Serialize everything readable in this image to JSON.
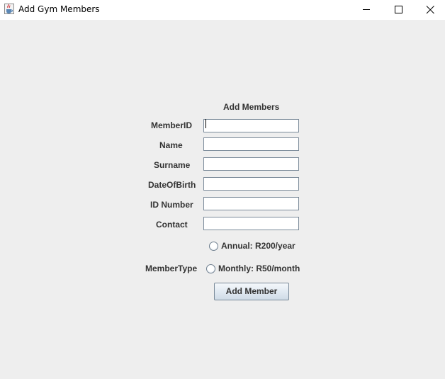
{
  "window": {
    "title": "Add Gym Members"
  },
  "form": {
    "heading": "Add Members",
    "fields": [
      {
        "label": "MemberID",
        "value": ""
      },
      {
        "label": "Name",
        "value": ""
      },
      {
        "label": "Surname",
        "value": ""
      },
      {
        "label": "DateOfBirth",
        "value": ""
      },
      {
        "label": "ID Number",
        "value": ""
      },
      {
        "label": "Contact",
        "value": ""
      }
    ],
    "member_type_label": "MemberType",
    "options": [
      {
        "label": "Annual: R200/year",
        "selected": false
      },
      {
        "label": "Monthly: R50/month",
        "selected": false
      }
    ],
    "submit_label": "Add Member"
  },
  "icons": {
    "app": "java-cup-icon",
    "minimize": "minimize-icon",
    "maximize": "maximize-icon",
    "close": "close-icon"
  }
}
